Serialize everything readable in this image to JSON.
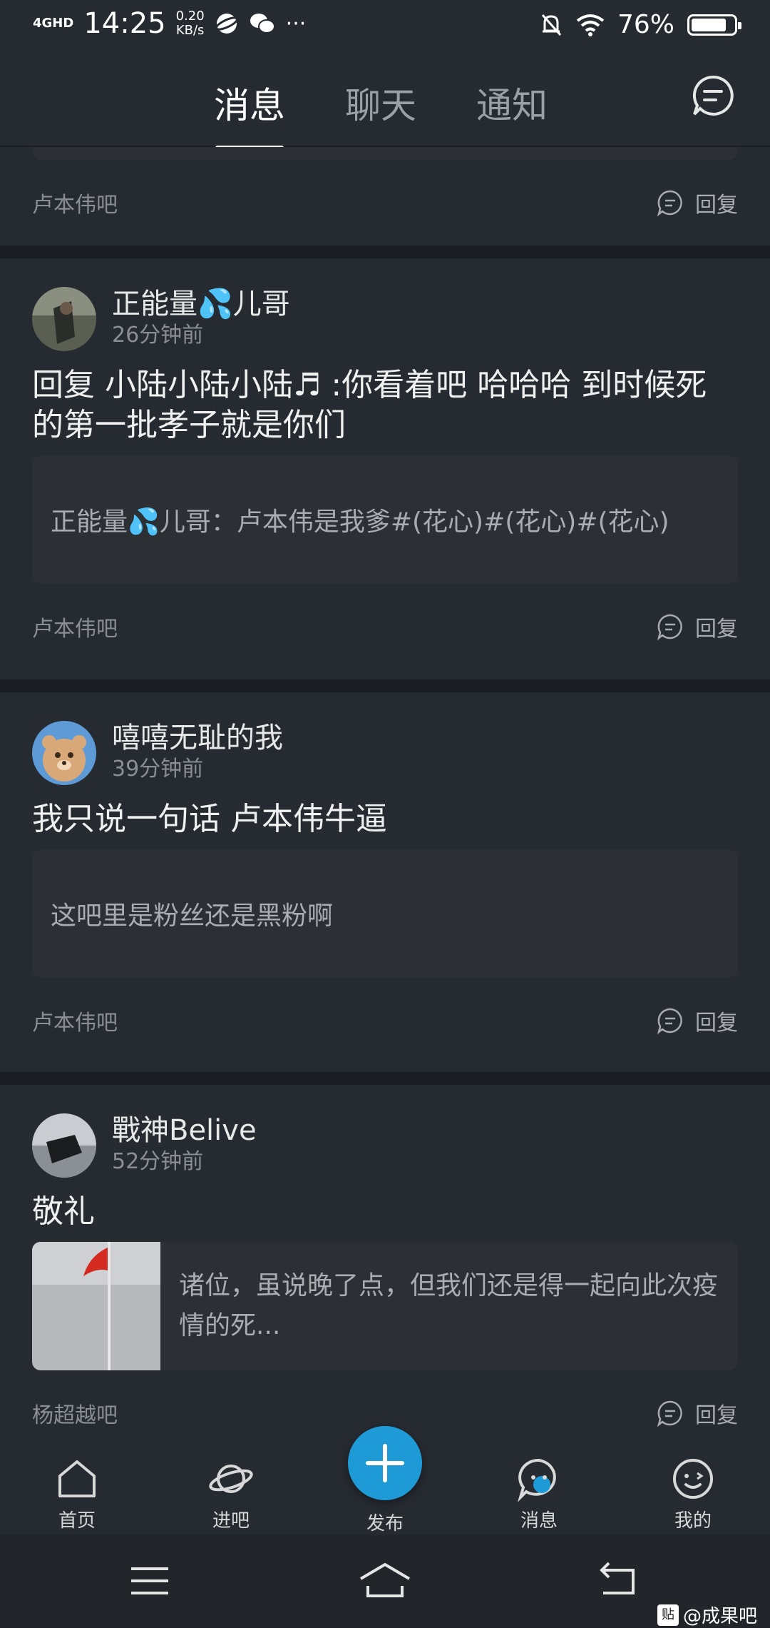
{
  "status_bar": {
    "network": "4GHD",
    "time": "14:25",
    "speed_value": "0.20",
    "speed_unit": "KB/s",
    "more": "···",
    "battery": "76%"
  },
  "header": {
    "tabs": [
      {
        "label": "消息",
        "active": true
      },
      {
        "label": "聊天",
        "active": false
      },
      {
        "label": "通知",
        "active": false
      }
    ]
  },
  "feed": {
    "top_partial": {
      "forum": "卢本伟吧",
      "reply": "回复"
    },
    "posts": [
      {
        "user": "正能量💦儿哥",
        "time": "26分钟前",
        "text": "回复 小陆小陆小陆♬ :你看着吧 哈哈哈 到时候死的第一批孝子就是你们",
        "quote": "正能量💦儿哥：卢本伟是我爹#(花心)#(花心)#(花心)",
        "forum": "卢本伟吧",
        "reply": "回复"
      },
      {
        "user": "嘻嘻无耻的我",
        "time": "39分钟前",
        "text": "我只说一句话 卢本伟牛逼",
        "quote": "这吧里是粉丝还是黑粉啊",
        "forum": "卢本伟吧",
        "reply": "回复"
      },
      {
        "user": "戰神Belive",
        "time": "52分钟前",
        "text": "敬礼",
        "quote": "诸位，虽说晚了点，但我们还是得一起向此次疫情的死...",
        "forum": "杨超越吧",
        "reply": "回复"
      }
    ]
  },
  "bottom_nav": {
    "items": [
      {
        "label": "首页",
        "icon": "home-icon"
      },
      {
        "label": "进吧",
        "icon": "planet-icon"
      },
      {
        "label": "发布",
        "icon": "plus-icon"
      },
      {
        "label": "消息",
        "icon": "message-icon"
      },
      {
        "label": "我的",
        "icon": "profile-icon"
      }
    ]
  },
  "watermark": {
    "badge": "贴",
    "text": "@成果吧"
  },
  "colors": {
    "accent": "#1e9bd7",
    "background": "#1f2328",
    "card": "#262b31"
  }
}
